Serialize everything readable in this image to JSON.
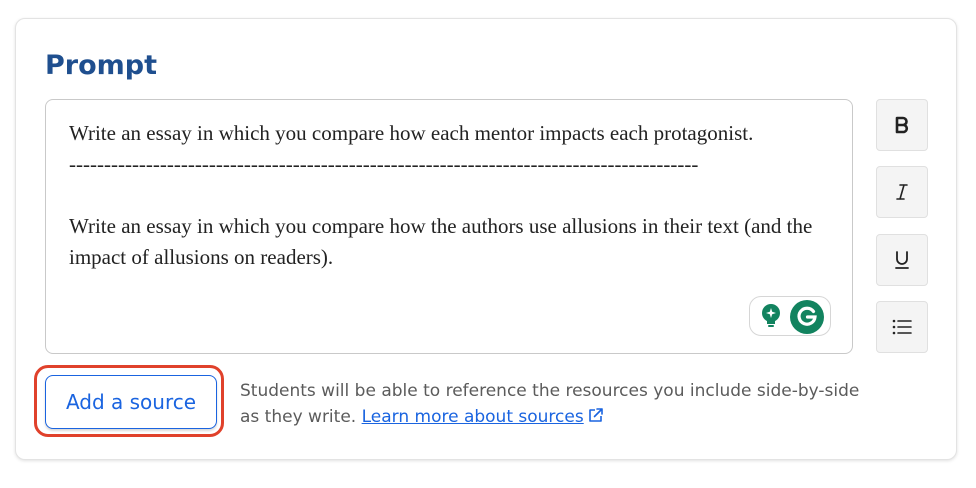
{
  "section": {
    "title": "Prompt"
  },
  "editor": {
    "paragraphs": [
      "Write an essay in which you compare how each mentor impacts each protagonist.",
      "------------------------------------------------------------------------------------------",
      "",
      "Write an essay in which you compare how the authors use allusions in their text (and the impact of allusions on readers)."
    ]
  },
  "toolbar": {
    "buttons": [
      {
        "name": "bold",
        "icon": "bold-icon"
      },
      {
        "name": "italic",
        "icon": "italic-icon"
      },
      {
        "name": "underline",
        "icon": "underline-icon"
      },
      {
        "name": "list",
        "icon": "bulleted-list-icon"
      }
    ]
  },
  "grammarly": {
    "icons": [
      "lightbulb-sparkle-icon",
      "grammarly-g-icon"
    ]
  },
  "sources": {
    "button_label": "Add a source",
    "help_text": "Students will be able to reference the resources you include side-by-side as they write.",
    "link_label": "Learn more about sources"
  },
  "colors": {
    "title": "#1f4f8f",
    "accent": "#1a64e0",
    "highlight": "#e0412b",
    "grammarly": "#12835f"
  }
}
